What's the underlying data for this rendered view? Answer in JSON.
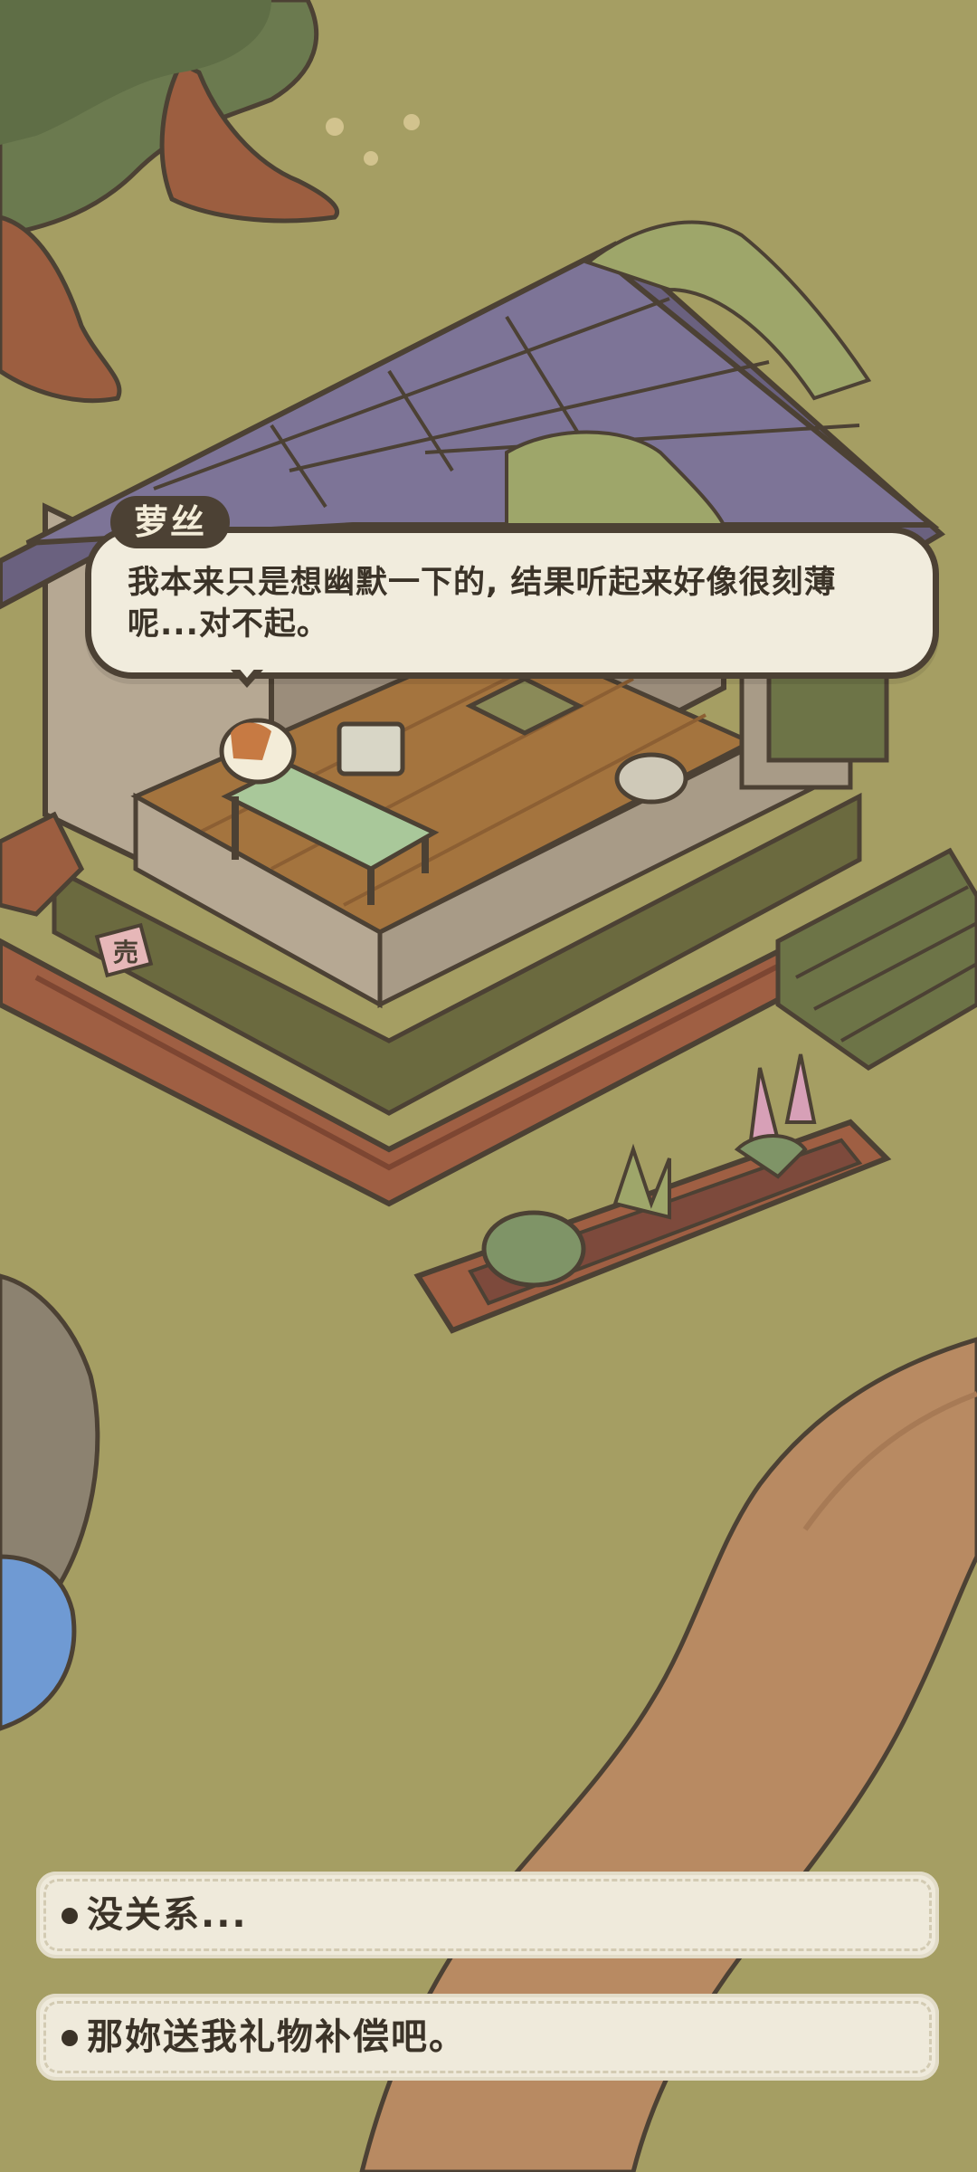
{
  "dialogue": {
    "speaker": "萝丝",
    "line1": "我本来只是想幽默一下的, 结果听起来好像很刻薄",
    "line2": "呢...对不起。"
  },
  "choices": [
    {
      "label": "没关系..."
    },
    {
      "label": "那妳送我礼物补偿吧。"
    }
  ],
  "scene": {
    "sign_text": "売"
  },
  "colors": {
    "grass": "#a59e63",
    "path": "#b88a62",
    "roof": "#7d7497",
    "bubble_bg": "#f1ecdd",
    "outline": "#4c4134"
  }
}
